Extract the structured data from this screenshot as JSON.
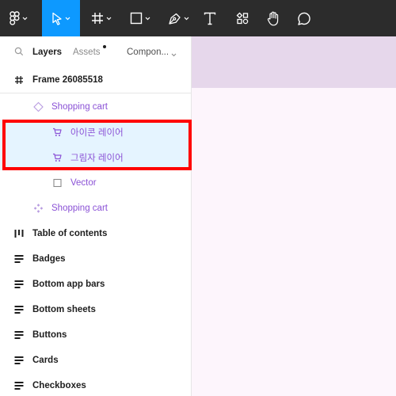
{
  "toolbar": {
    "tools": [
      {
        "name": "main-menu",
        "icon": "figma-logo-icon",
        "has_chevron": true,
        "active": false
      },
      {
        "name": "move",
        "icon": "cursor-arrow-icon",
        "has_chevron": true,
        "active": true
      },
      {
        "name": "frame",
        "icon": "hash-frame-icon",
        "has_chevron": true,
        "active": false
      },
      {
        "name": "shape",
        "icon": "rectangle-icon",
        "has_chevron": true,
        "active": false
      },
      {
        "name": "pen",
        "icon": "pen-icon",
        "has_chevron": true,
        "active": false
      },
      {
        "name": "text",
        "icon": "text-icon",
        "has_chevron": false,
        "active": false
      },
      {
        "name": "resources",
        "icon": "resources-icon",
        "has_chevron": false,
        "active": false
      },
      {
        "name": "hand",
        "icon": "hand-icon",
        "has_chevron": false,
        "active": false
      },
      {
        "name": "comment",
        "icon": "comment-icon",
        "has_chevron": false,
        "active": false
      }
    ],
    "colors": {
      "bg": "#2c2c2c",
      "active": "#0d99ff"
    }
  },
  "panel": {
    "tabs": {
      "layers": "Layers",
      "assets": "Assets",
      "components": "Compon..."
    },
    "frame": {
      "label": "Frame 26085518",
      "icon": "hash-frame-icon"
    },
    "layers": [
      {
        "label": "Shopping cart",
        "icon": "component-instance-icon",
        "indent": 1,
        "color": "purple",
        "selected": false
      },
      {
        "label": "아이콘 레이어",
        "icon": "shopping-cart-icon",
        "indent": 2,
        "color": "purple",
        "selected": true
      },
      {
        "label": "그림자 레이어",
        "icon": "shopping-cart-icon",
        "indent": 2,
        "color": "purple",
        "selected": true
      },
      {
        "label": "Vector",
        "icon": "vector-square-icon",
        "indent": 2,
        "color": "purple",
        "selected": false
      },
      {
        "label": "Shopping cart",
        "icon": "component-set-icon",
        "indent": 1,
        "color": "purple",
        "selected": false
      },
      {
        "label": "Table of contents",
        "icon": "columns-icon",
        "indent": 0,
        "color": "dark",
        "selected": false
      },
      {
        "label": "Badges",
        "icon": "section-lines-icon",
        "indent": 0,
        "color": "dark",
        "selected": false
      },
      {
        "label": "Bottom app bars",
        "icon": "section-lines-icon",
        "indent": 0,
        "color": "dark",
        "selected": false
      },
      {
        "label": "Bottom sheets",
        "icon": "section-lines-icon",
        "indent": 0,
        "color": "dark",
        "selected": false
      },
      {
        "label": "Buttons",
        "icon": "section-lines-icon",
        "indent": 0,
        "color": "dark",
        "selected": false
      },
      {
        "label": "Cards",
        "icon": "section-lines-icon",
        "indent": 0,
        "color": "dark",
        "selected": false
      },
      {
        "label": "Checkboxes",
        "icon": "section-lines-icon",
        "indent": 0,
        "color": "dark",
        "selected": false
      }
    ],
    "colors": {
      "purple": "#8b52d6",
      "selected_bg": "#e5f4ff",
      "highlight": "#ff0000"
    }
  },
  "canvas": {
    "colors": {
      "bg": "#fdf5fc",
      "top_band": "#e6d7eb"
    }
  }
}
